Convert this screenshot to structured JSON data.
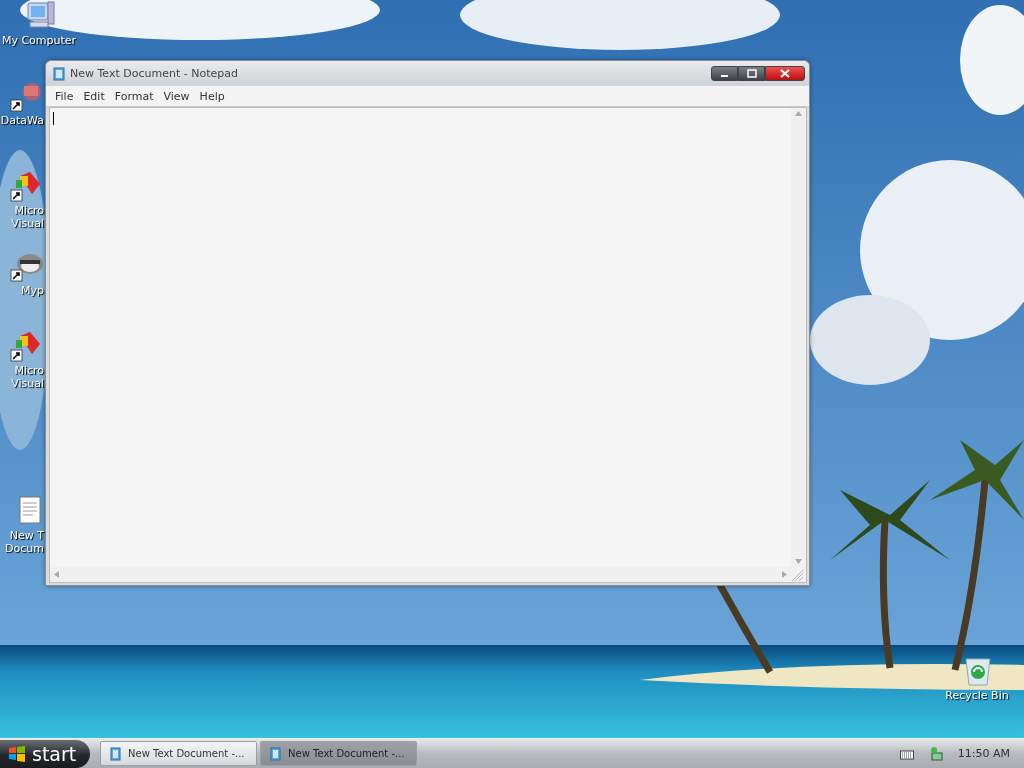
{
  "desktop_icons": [
    {
      "kind": "computer",
      "shortcut": false,
      "lines": [
        "My Computer"
      ]
    },
    {
      "kind": "app",
      "shortcut": true,
      "lines": [
        "DataWa"
      ]
    },
    {
      "kind": "studio",
      "shortcut": true,
      "lines": [
        "Micro",
        "Visual"
      ]
    },
    {
      "kind": "raccoon",
      "shortcut": true,
      "lines": [
        "Myp"
      ]
    },
    {
      "kind": "studio",
      "shortcut": true,
      "lines": [
        "Micro",
        "Visual"
      ]
    },
    {
      "kind": "document",
      "shortcut": false,
      "lines": [
        "New T",
        "Docum"
      ]
    },
    {
      "kind": "recycle",
      "shortcut": false,
      "lines": [
        "Recycle Bin"
      ]
    }
  ],
  "window": {
    "title": "New Text Document - Notepad",
    "menu": [
      "File",
      "Edit",
      "Format",
      "View",
      "Help"
    ]
  },
  "taskbar": {
    "start": "start",
    "tasks": [
      {
        "label": "New Text Document -...",
        "selected": false
      },
      {
        "label": "New Text Document -...",
        "selected": true
      }
    ],
    "clock": "11:50 AM"
  }
}
